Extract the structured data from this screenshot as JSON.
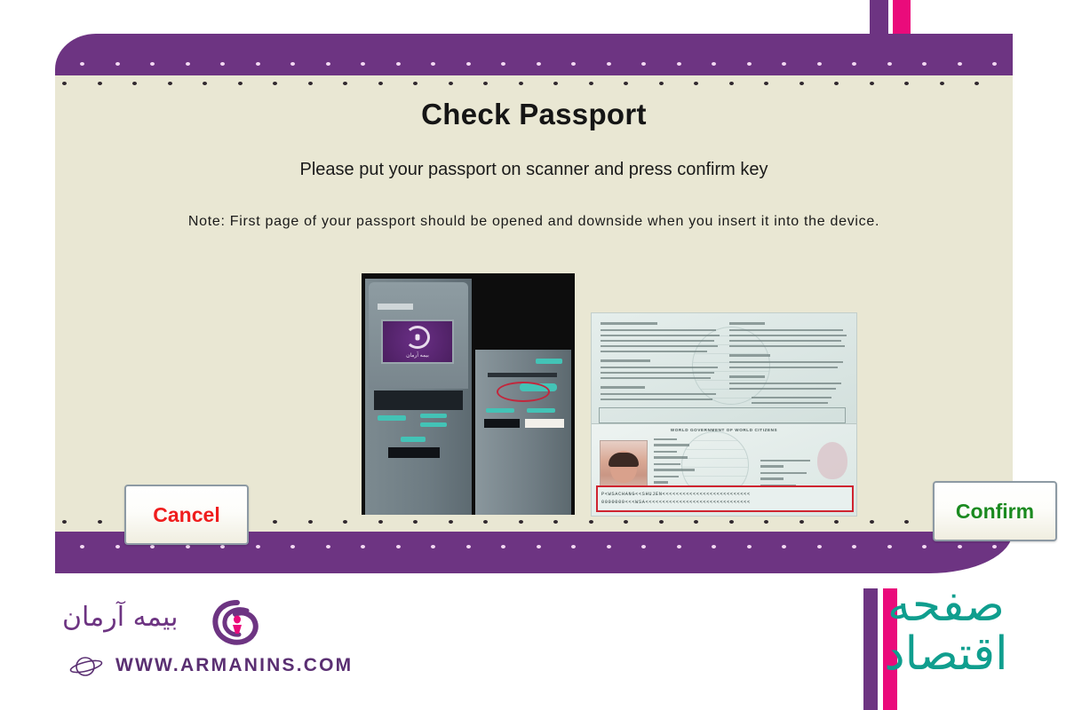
{
  "window": {
    "background_color": "#ffffff",
    "canvas_color": "#e9e7d3",
    "accent_purple": "#6d3482",
    "accent_magenta": "#ea0b7b",
    "accent_teal": "#0f9e8e"
  },
  "screen": {
    "title": "Check Passport",
    "subtitle": "Please put your passport on scanner and press confirm key",
    "note": "Note: First page of your passport should be opened and downside when you insert it into the device."
  },
  "buttons": {
    "cancel_label": "Cancel",
    "cancel_color": "#ef1d1d",
    "confirm_label": "Confirm",
    "confirm_color": "#1a8a1f"
  },
  "illustrations": {
    "atm": {
      "name": "atm-kiosk-photo",
      "screen_logo_label": "بیمه آرمان",
      "highlight_caption": "passport scanner slot"
    },
    "passport": {
      "name": "passport-open-photo",
      "header": "WORLD GOVERNMENT OF WORLD CITIZENS",
      "mrz_line1": "P<WSACHANG<<SHUJEN<<<<<<<<<<<<<<<<<<<<<<<<<<",
      "mrz_line2": "0000000<<<WSA<<<<<<<<<<<<<<<<<<<<<<<<<<<<<<<"
    }
  },
  "brand": {
    "name_fa": "بیمه آرمان",
    "website": "WWW.ARMANINS.COM"
  },
  "watermark": {
    "text_fa": "صفحه اقتصاد"
  }
}
